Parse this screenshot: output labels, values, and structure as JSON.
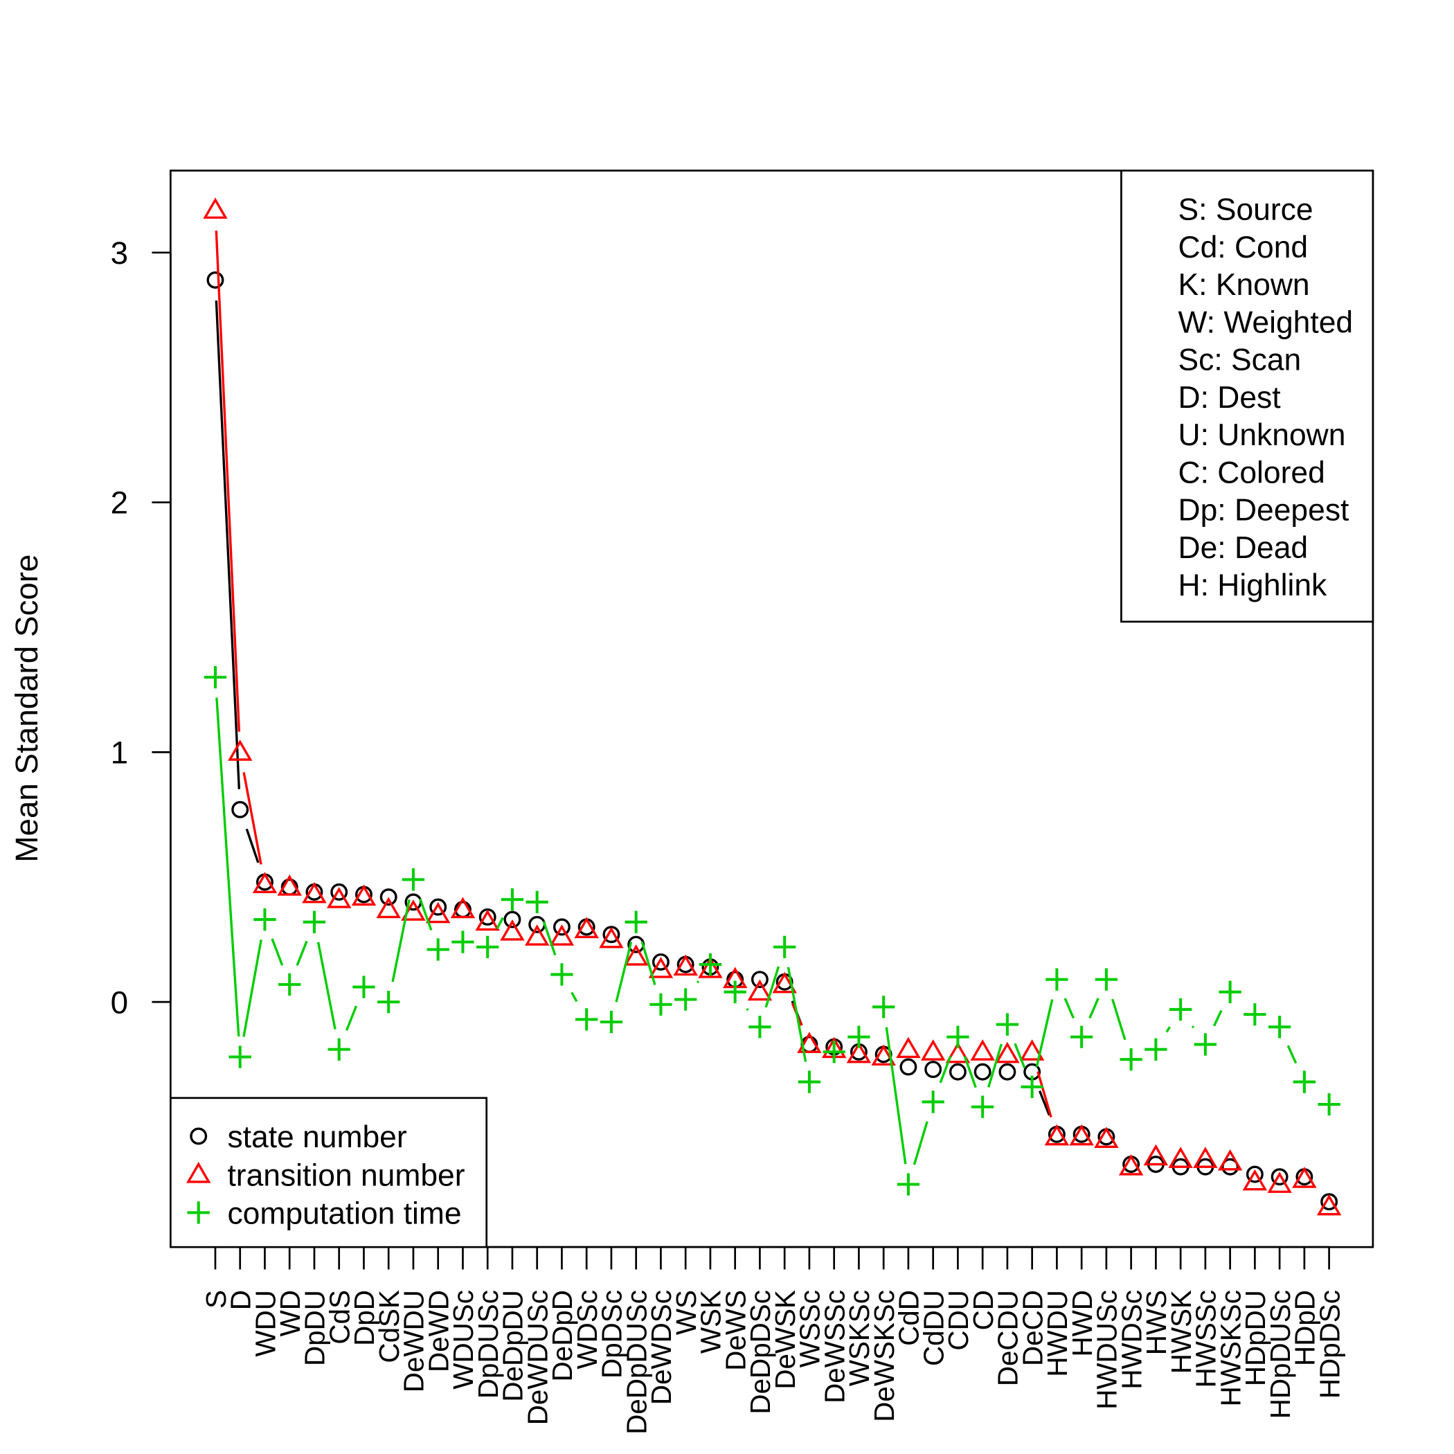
{
  "chart_data": {
    "type": "line",
    "title": "",
    "xlabel": "",
    "ylabel": "Mean Standard Score",
    "ylim": [
      -0.98,
      3.33
    ],
    "yticks": [
      0,
      1,
      2,
      3
    ],
    "ytick_labels": [
      "0",
      "1",
      "2",
      "3"
    ],
    "grid": false,
    "categories": [
      "S",
      "D",
      "WDU",
      "WD",
      "DpDU",
      "CdS",
      "DpD",
      "CdSK",
      "DeWDU",
      "DeWD",
      "WDUSc",
      "DpDUSc",
      "DeDpDU",
      "DeWDUSc",
      "DeDpD",
      "WDSc",
      "DpDSc",
      "DeDpDUSc",
      "DeWDSc",
      "WS",
      "WSK",
      "DeWS",
      "DeDpDSc",
      "DeWSK",
      "WSSc",
      "DeWSSc",
      "WSKSc",
      "DeWSKSc",
      "CdD",
      "CdDU",
      "CDU",
      "CD",
      "DeCDU",
      "DeCD",
      "HWDU",
      "HWD",
      "HWDUSc",
      "HWDSc",
      "HWS",
      "HWSK",
      "HWSSc",
      "HWSKSc",
      "HDpDU",
      "HDpDUSc",
      "HDpD",
      "HDpDSc"
    ],
    "series": [
      {
        "name": "state number",
        "color": "#000000",
        "marker": "circle",
        "values": [
          2.89,
          0.77,
          0.48,
          0.46,
          0.44,
          0.44,
          0.43,
          0.42,
          0.4,
          0.38,
          0.37,
          0.34,
          0.33,
          0.31,
          0.3,
          0.3,
          0.27,
          0.23,
          0.16,
          0.15,
          0.14,
          0.09,
          0.09,
          0.08,
          -0.17,
          -0.18,
          -0.2,
          -0.21,
          -0.26,
          -0.27,
          -0.28,
          -0.28,
          -0.28,
          -0.28,
          -0.53,
          -0.53,
          -0.54,
          -0.65,
          -0.65,
          -0.66,
          -0.66,
          -0.66,
          -0.69,
          -0.7,
          -0.7,
          -0.8
        ]
      },
      {
        "name": "transition number",
        "color": "#ff0000",
        "marker": "triangle",
        "values": [
          3.17,
          1.0,
          0.47,
          0.46,
          0.43,
          0.41,
          0.42,
          0.37,
          0.36,
          0.35,
          0.37,
          0.32,
          0.28,
          0.26,
          0.26,
          0.29,
          0.25,
          0.18,
          0.13,
          0.14,
          0.13,
          0.09,
          0.04,
          0.07,
          -0.17,
          -0.19,
          -0.21,
          -0.22,
          -0.19,
          -0.2,
          -0.21,
          -0.2,
          -0.21,
          -0.2,
          -0.54,
          -0.54,
          -0.55,
          -0.66,
          -0.62,
          -0.63,
          -0.63,
          -0.64,
          -0.72,
          -0.73,
          -0.71,
          -0.82
        ]
      },
      {
        "name": "computation time",
        "color": "#00cc00",
        "marker": "plus",
        "values": [
          1.3,
          -0.22,
          0.33,
          0.07,
          0.32,
          -0.19,
          0.06,
          0.0,
          0.49,
          0.21,
          0.24,
          0.22,
          0.41,
          0.4,
          0.11,
          -0.07,
          -0.08,
          0.32,
          -0.01,
          0.01,
          0.15,
          0.04,
          -0.1,
          0.22,
          -0.32,
          -0.2,
          -0.14,
          -0.02,
          -0.73,
          -0.4,
          -0.14,
          -0.42,
          -0.09,
          -0.34,
          0.09,
          -0.14,
          0.09,
          -0.23,
          -0.19,
          -0.03,
          -0.17,
          0.04,
          -0.05,
          -0.1,
          -0.32,
          -0.41
        ]
      }
    ],
    "legend": {
      "placement": "bottom-left",
      "entries": [
        "state number",
        "transition number",
        "computation time"
      ]
    },
    "key_box": {
      "placement": "top-right",
      "lines": [
        "S: Source",
        "Cd: Cond",
        "K: Known",
        "W: Weighted",
        "Sc: Scan",
        "D: Dest",
        "U: Unknown",
        "C: Colored",
        "Dp: Deepest",
        "De: Dead",
        "H: Highlink"
      ]
    }
  }
}
